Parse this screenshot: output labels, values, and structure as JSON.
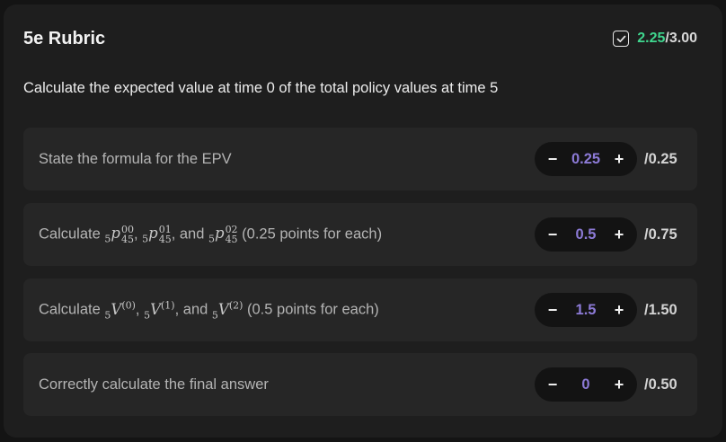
{
  "rubric": {
    "title": "5e Rubric",
    "score_obtained": "2.25",
    "score_separator": "/",
    "score_total": "3.00",
    "icon": "checkbox-check-icon"
  },
  "question": "Calculate the expected value at time 0 of the total policy values at time 5",
  "criteria": [
    {
      "label": "State the formula for the EPV",
      "value": "0.25",
      "max": "/0.25"
    },
    {
      "label_prefix": "Calculate",
      "label_mid1": ",",
      "label_mid2": ", and",
      "label_suffix": "(0.25 points for each)",
      "value": "0.5",
      "max": "/0.75",
      "math": [
        "5",
        "p",
        "00",
        "45",
        "5",
        "p",
        "01",
        "45",
        "5",
        "p",
        "02",
        "45"
      ]
    },
    {
      "label_prefix": "Calculate",
      "label_mid1": ",",
      "label_mid2": ", and",
      "label_suffix": "(0.5 points for each)",
      "value": "1.5",
      "max": "/1.50",
      "math": [
        "5",
        "V",
        "(0)",
        "5",
        "V",
        "(1)",
        "5",
        "V",
        "(2)"
      ]
    },
    {
      "label": "Correctly calculate the final answer",
      "value": "0",
      "max": "/0.50"
    }
  ],
  "controls": {
    "minus": "−",
    "plus": "+"
  },
  "colors": {
    "score_green": "#3fd68e",
    "value_purple": "#8c7ad6"
  }
}
